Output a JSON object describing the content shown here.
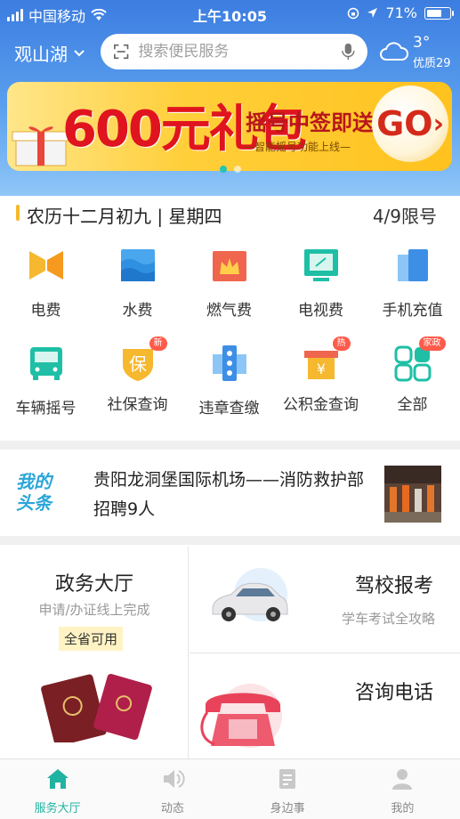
{
  "status_bar": {
    "carrier": "中国移动",
    "time": "上午10:05",
    "battery": "71%",
    "battery_level": 0.71
  },
  "top_bar": {
    "city": "观山湖",
    "search_placeholder": "搜索便民服务",
    "temperature": "3°",
    "air_quality": "优质29"
  },
  "banner": {
    "headline": "600元礼包",
    "slogan": "摇号中签即送",
    "subtitle": "—智能摇号功能上线—",
    "go_label": "GO",
    "go_arrow": "›",
    "page_count": 2,
    "active_page": 1
  },
  "date_row": {
    "lunar_date": "农历十二月初九 | 星期四",
    "plate_limit": "4/9限号"
  },
  "services_grid": {
    "row1": [
      {
        "label": "电费",
        "icon": "electricity-icon"
      },
      {
        "label": "水费",
        "icon": "water-icon"
      },
      {
        "label": "燃气费",
        "icon": "gas-icon"
      },
      {
        "label": "电视费",
        "icon": "tv-icon"
      },
      {
        "label": "手机充值",
        "icon": "phone-recharge-icon"
      }
    ],
    "row2": [
      {
        "label": "车辆摇号",
        "icon": "vehicle-lottery-icon",
        "badge": ""
      },
      {
        "label": "社保查询",
        "icon": "social-security-icon",
        "badge": "新",
        "icon_text": "保"
      },
      {
        "label": "违章查缴",
        "icon": "traffic-violation-icon",
        "badge": ""
      },
      {
        "label": "公积金查询",
        "icon": "housing-fund-icon",
        "badge": "热",
        "icon_text": "¥"
      },
      {
        "label": "全部",
        "icon": "all-services-icon",
        "badge": "家政"
      }
    ]
  },
  "headline_news": {
    "logo_line1": "我的",
    "logo_line2": "头条",
    "title": "贵阳龙洞堡国际机场——消防救护部招聘9人"
  },
  "feature_cards": {
    "government_hall": {
      "title": "政务大厅",
      "subtitle": "申请/办证线上完成",
      "badge": "全省可用"
    },
    "driving_school": {
      "title": "驾校报考",
      "subtitle": "学车考试全攻略"
    },
    "hotline": {
      "title": "咨询电话"
    }
  },
  "tab_bar": [
    {
      "label": "服务大厅",
      "icon": "home-icon",
      "active": true
    },
    {
      "label": "动态",
      "icon": "speaker-icon",
      "active": false
    },
    {
      "label": "身边事",
      "icon": "document-icon",
      "active": false
    },
    {
      "label": "我的",
      "icon": "user-icon",
      "active": false
    }
  ],
  "colors": {
    "header_blue": "#3c7de0",
    "accent_teal": "#21b3a1",
    "banner_yellow": "#ffc21e",
    "banner_red": "#e0141e",
    "badge_red": "#ff5b4a"
  }
}
